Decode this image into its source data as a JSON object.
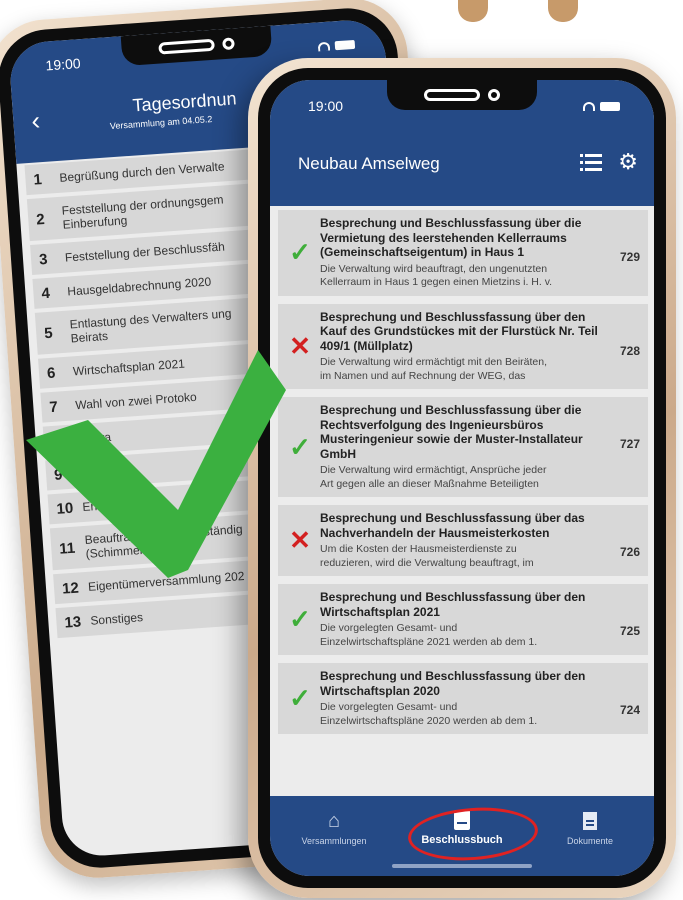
{
  "back_phone": {
    "time": "19:00",
    "title": "Tagesordnun",
    "subtitle": "Versammlung am 04.05.2",
    "agenda": [
      {
        "num": "1",
        "text": "Begrüßung durch den Verwalte"
      },
      {
        "num": "2",
        "text": "Feststellung der ordnungsgem\nEinberufung"
      },
      {
        "num": "3",
        "text": "Feststellung der Beschlussfäh"
      },
      {
        "num": "4",
        "text": "Hausgeldabrechnung 2020"
      },
      {
        "num": "5",
        "text": "Entlastung des Verwalters ung\nBeirats"
      },
      {
        "num": "6",
        "text": "Wirtschaftsplan 2021"
      },
      {
        "num": "7",
        "text": "Wahl von zwei Protoko"
      },
      {
        "num": "8",
        "text": "                     Verwa"
      },
      {
        "num": "9",
        "text": "Eig"
      },
      {
        "num": "10",
        "text": "Erneuerung              ter"
      },
      {
        "num": "11",
        "text": "Beauftragung Sachverständig\n(Schimmelbildung)"
      },
      {
        "num": "12",
        "text": "Eigentümerversammlung 202"
      },
      {
        "num": "13",
        "text": "Sonstiges"
      }
    ]
  },
  "front_phone": {
    "time": "19:00",
    "app_title": "Neubau Amselweg",
    "resolutions": [
      {
        "status": "accepted",
        "title": "Besprechung und Beschlussfassung über die Vermietung des leerstehenden Kellerraums (Gemeinschaftseigentum) in Haus 1",
        "number": "729",
        "desc1": "Die Verwaltung wird beauftragt, den ungenutzten",
        "desc2": "Kellerraum in Haus 1 gegen einen Mietzins i. H. v."
      },
      {
        "status": "rejected",
        "title": "Besprechung und Beschlussfassung über den Kauf des Grundstückes mit der Flurstück Nr. Teil 409/1 (Müllplatz)",
        "number": "728",
        "desc1": "Die Verwaltung wird ermächtigt mit den Beiräten,",
        "desc2": "im Namen und auf Rechnung der WEG, das"
      },
      {
        "status": "accepted",
        "title": "Besprechung und Beschlussfassung über die Rechtsverfolgung des Ingenieursbüros Musteringenieur sowie der Muster-Installateur GmbH",
        "number": "727",
        "desc1": "Die Verwaltung wird ermächtigt, Ansprüche jeder",
        "desc2": "Art gegen alle an dieser Maßnahme Beteiligten"
      },
      {
        "status": "rejected",
        "title": "Besprechung und Beschlussfassung über das Nachverhandeln der Hausmeisterkosten",
        "number": "726",
        "desc1": "Um die Kosten der Hausmeisterdienste zu",
        "desc2": "reduzieren, wird die Verwaltung beauftragt, im"
      },
      {
        "status": "accepted",
        "title": "Besprechung und Beschlussfassung über den Wirtschaftsplan 2021",
        "number": "725",
        "desc1": "Die vorgelegten Gesamt- und",
        "desc2": "Einzelwirtschaftspläne 2021 werden ab dem 1."
      },
      {
        "status": "accepted",
        "title": "Besprechung und Beschlussfassung über den Wirtschaftsplan 2020",
        "number": "724",
        "desc1": "Die vorgelegten Gesamt- und",
        "desc2": "Einzelwirtschaftspläne 2020 werden ab dem 1."
      }
    ],
    "tabs": [
      {
        "label": "Versammlungen",
        "icon": "home-icon"
      },
      {
        "label": "Beschlussbuch",
        "icon": "book-icon"
      },
      {
        "label": "Dokumente",
        "icon": "document-icon"
      }
    ],
    "active_tab": "Beschlussbuch"
  },
  "colors": {
    "header_blue": "#254a86",
    "item_gray": "#d8d8d8",
    "accepted_green": "#3fae3a",
    "rejected_red": "#d32020",
    "highlight_red": "#e02222",
    "frame_gold": "#caa989"
  }
}
